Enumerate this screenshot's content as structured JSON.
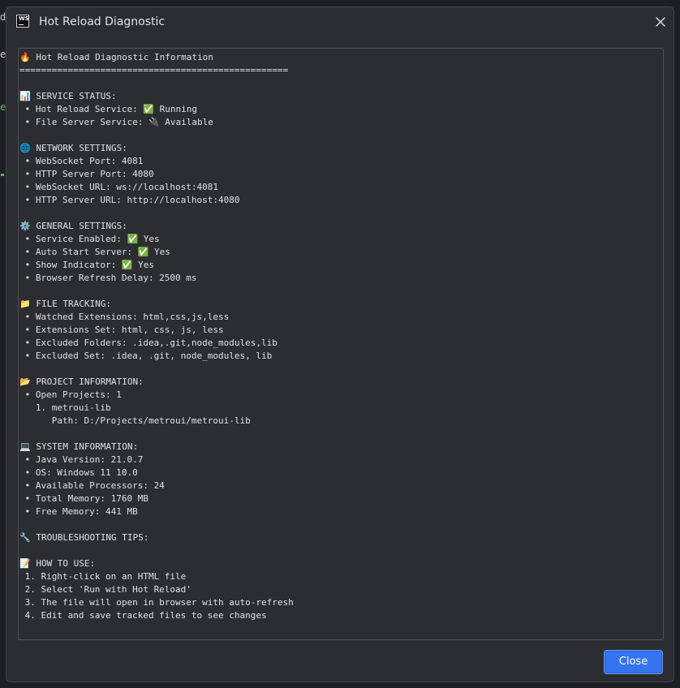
{
  "window": {
    "title": "Hot Reload Diagnostic",
    "app_icon_text": "WS"
  },
  "background_editor": {
    "fragments": [
      "d",
      "e",
      "e"
    ]
  },
  "diagnostic_log": "🔥 Hot Reload Diagnostic Information\n==================================================\n\n📊 SERVICE STATUS:\n • Hot Reload Service: ✅ Running\n • File Server Service: 🔌 Available\n\n🌐 NETWORK SETTINGS:\n • WebSocket Port: 4081\n • HTTP Server Port: 4080\n • WebSocket URL: ws://localhost:4081\n • HTTP Server URL: http://localhost:4080\n\n⚙️ GENERAL SETTINGS:\n • Service Enabled: ✅ Yes\n • Auto Start Server: ✅ Yes\n • Show Indicator: ✅ Yes\n • Browser Refresh Delay: 2500 ms\n\n📁 FILE TRACKING:\n • Watched Extensions: html,css,js,less\n • Extensions Set: html, css, js, less\n • Excluded Folders: .idea,.git,node_modules,lib\n • Excluded Set: .idea, .git, node_modules, lib\n\n📂 PROJECT INFORMATION:\n • Open Projects: 1\n   1. metroui-lib\n      Path: D:/Projects/metroui/metroui-lib\n\n💻 SYSTEM INFORMATION:\n • Java Version: 21.0.7\n • OS: Windows 11 10.0\n • Available Processors: 24\n • Total Memory: 1760 MB\n • Free Memory: 441 MB\n\n🔧 TROUBLESHOOTING TIPS:\n\n📝 HOW TO USE:\n 1. Right-click on an HTML file\n 2. Select 'Run with Hot Reload'\n 3. The file will open in browser with auto-refresh\n 4. Edit and save tracked files to see changes",
  "buttons": {
    "close_label": "Close"
  },
  "colors": {
    "dialog_background": "#2b2d30",
    "accent": "#3574f0",
    "text": "#dfe1e5"
  }
}
